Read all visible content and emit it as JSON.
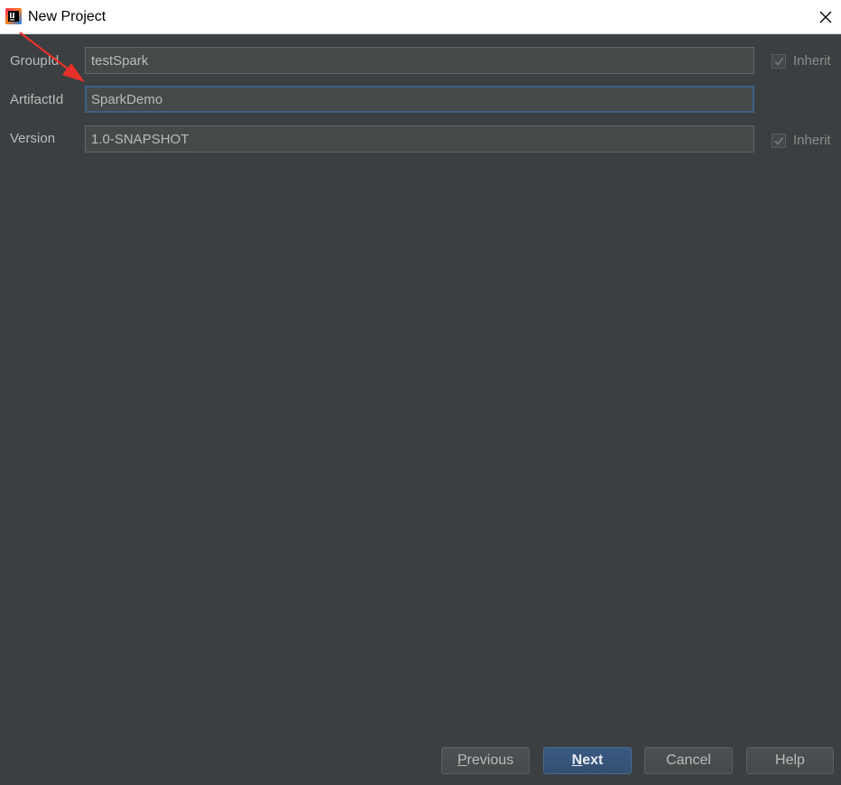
{
  "window": {
    "title": "New Project",
    "icon": "intellij-idea-icon"
  },
  "form": {
    "group_id": {
      "label": "GroupId",
      "value": "testSpark",
      "inherit_label": "Inherit",
      "inherit_checked": true
    },
    "artifact_id": {
      "label": "ArtifactId",
      "value": "SparkDemo"
    },
    "version": {
      "label": "Version",
      "value": "1.0-SNAPSHOT",
      "inherit_label": "Inherit",
      "inherit_checked": true
    }
  },
  "buttons": {
    "previous": {
      "mnemonic": "P",
      "rest": "revious"
    },
    "next": {
      "mnemonic": "N",
      "rest": "ext"
    },
    "cancel": "Cancel",
    "help": "Help"
  },
  "colors": {
    "background": "#3c3f41",
    "field_bg": "#45494a",
    "focus_border": "#3d6185",
    "annotation_arrow": "#e8302a",
    "default_button": "#365880"
  }
}
